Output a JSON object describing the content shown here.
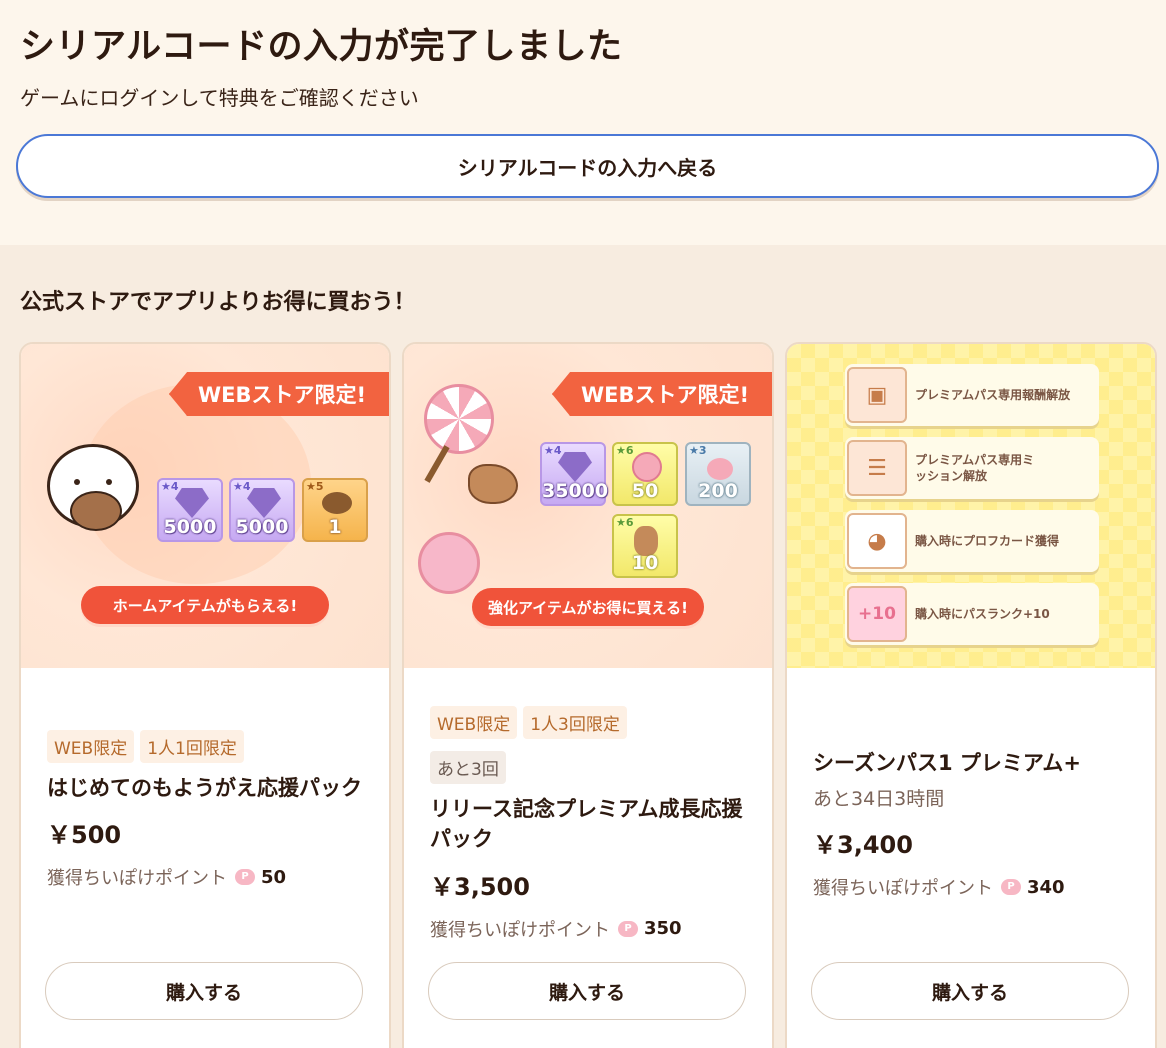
{
  "header": {
    "title": "シリアルコードの入力が完了しました",
    "subtitle": "ゲームにログインして特典をご確認ください",
    "back_button": "シリアルコードの入力へ戻る"
  },
  "store": {
    "section_title": "公式ストアでアプリよりお得に買おう！",
    "points_label": "獲得ちいぽけポイント",
    "buy_label": "購入する",
    "products": [
      {
        "banner": {
          "ribbon": "WEBストア限定!",
          "pill": "ホームアイテムがもらえる!",
          "items": [
            "5000",
            "5000",
            "1"
          ]
        },
        "tags": [
          "WEB限定",
          "1人1回限定"
        ],
        "name": "はじめてのもようがえ応援パック",
        "price": "￥500",
        "points": "50"
      },
      {
        "banner": {
          "ribbon": "WEBストア限定!",
          "pill": "強化アイテムがお得に買える!",
          "items": [
            "35000",
            "50",
            "200",
            "10"
          ]
        },
        "tags": [
          "WEB限定",
          "1人3回限定"
        ],
        "remaining": "あと3回",
        "name": "リリース記念プレミアム成長応援パック",
        "price": "￥3,500",
        "points": "350"
      },
      {
        "banner": {
          "features": [
            "プレミアムパス専用報酬解放",
            "プレミアムパス専用ミッション解放",
            "購入時にプロフカード獲得",
            "購入時にパスランク+10"
          ],
          "rank_badge": "+10"
        },
        "name": "シーズンパス1 プレミアム+",
        "remaining": "あと34日3時間",
        "price": "￥3,400",
        "points": "340"
      }
    ]
  }
}
